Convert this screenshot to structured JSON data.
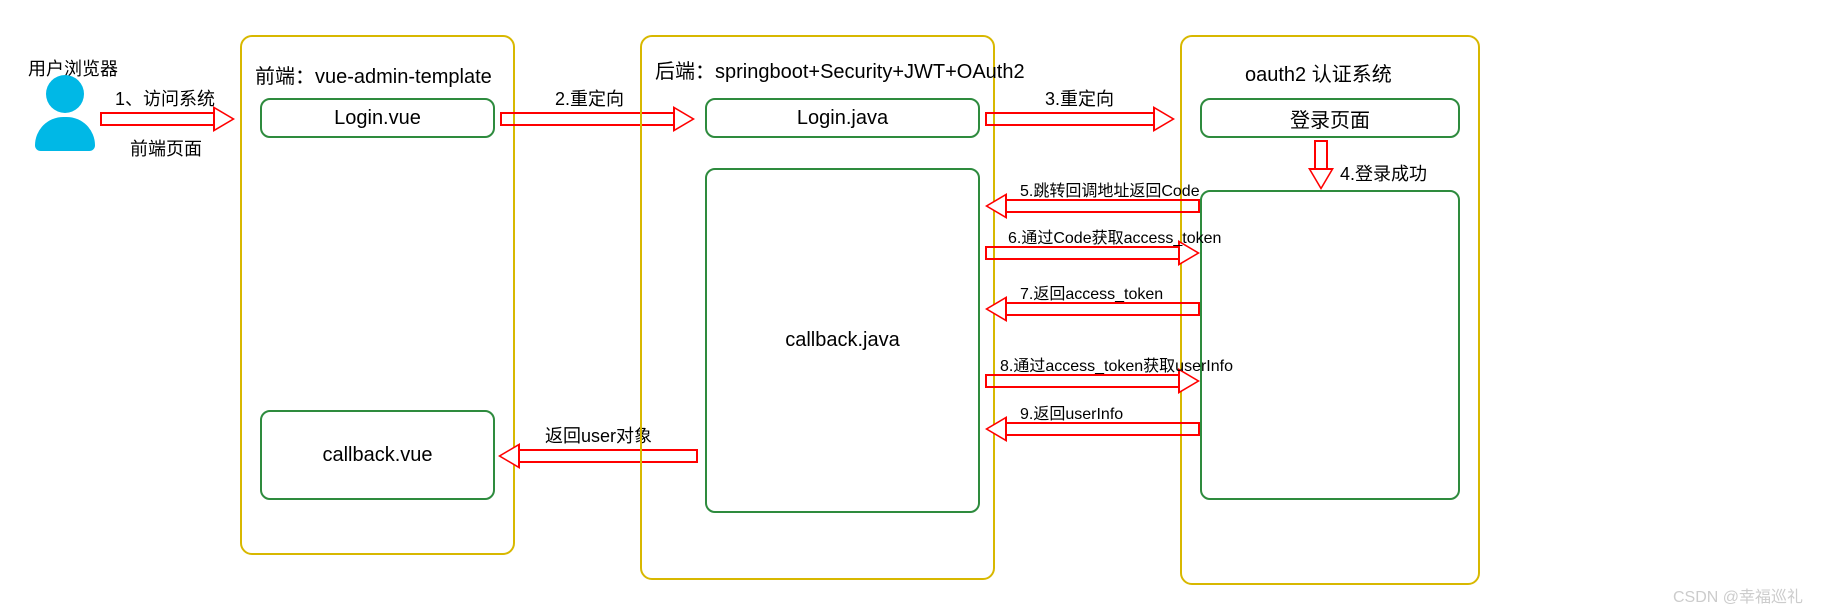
{
  "user": {
    "title": "用户浏览器"
  },
  "arrow1": {
    "label": "1、访问系统",
    "sub": "前端页面"
  },
  "frontend": {
    "title": "前端：vue-admin-template",
    "login_box": "Login.vue",
    "callback_box": "callback.vue"
  },
  "arrow2": {
    "label": "2.重定向"
  },
  "arrowReturn": {
    "label": "返回user对象"
  },
  "backend": {
    "title": "后端：springboot+Security+JWT+OAuth2",
    "login_box": "Login.java",
    "callback_box": "callback.java"
  },
  "arrow3": {
    "label": "3.重定向"
  },
  "oauth": {
    "title": "oauth2 认证系统",
    "login_box": "登录页面"
  },
  "arrow4": {
    "label": "4.登录成功"
  },
  "flows": {
    "s5": "5.跳转回调地址返回Code",
    "s6": "6.通过Code获取access_token",
    "s7": "7.返回access_token",
    "s8": "8.通过access_token获取userInfo",
    "s9": "9.返回userInfo"
  },
  "watermark": "CSDN @幸福巡礼"
}
